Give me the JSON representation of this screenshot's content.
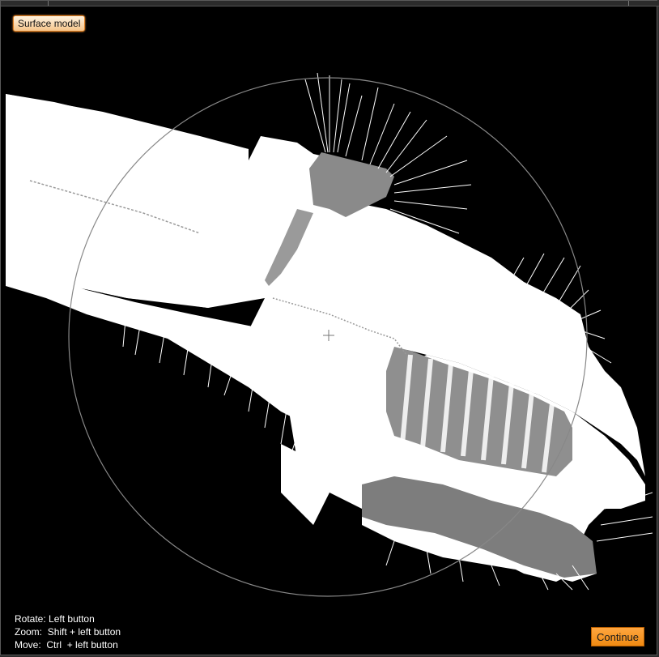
{
  "window": {
    "title": ""
  },
  "viewport": {
    "mode_label": "Surface model",
    "content": "3D surface point cloud view with rotation trackball"
  },
  "help": {
    "rotate_label": "Rotate:",
    "rotate_value": "Left button",
    "zoom_label": "Zoom:",
    "zoom_value": "Shift + left button",
    "move_label": "Move:",
    "move_value": "Ctrl  + left button"
  },
  "actions": {
    "continue_label": "Continue"
  },
  "colors": {
    "accent": "#f39a2a",
    "background": "#000000",
    "surface": "#ffffff",
    "trackball": "#888888"
  },
  "icons": [
    "crosshair-icon",
    "trackball-circle"
  ]
}
